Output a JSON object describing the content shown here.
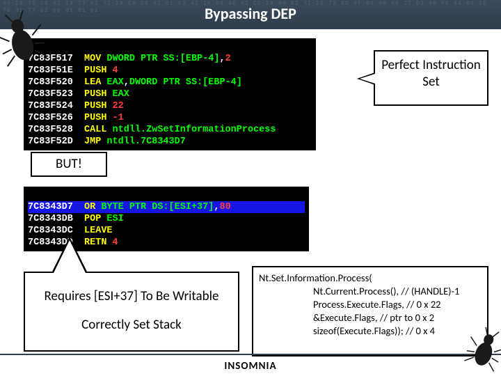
{
  "header": {
    "title": "Bypassing DEP"
  },
  "callouts": {
    "perfect": "Perfect Instruction Set",
    "but": "BUT!",
    "req_line1": "Requires [ESI+37] To Be Writable",
    "req_line2": "Correctly Set Stack"
  },
  "disasm1": [
    {
      "addr": "7C83F517",
      "mn": "MOV ",
      "ptr": "DWORD PTR SS:[EBP-4]",
      "comma": ",",
      "arg": "2",
      "arg_class": "num"
    },
    {
      "addr": "7C83F51E",
      "mn": "PUSH ",
      "arg": "4",
      "arg_class": "num"
    },
    {
      "addr": "7C83F520",
      "mn": "LEA ",
      "reg": "EAX",
      "comma": ",",
      "ptr": "DWORD PTR SS:[EBP-4]"
    },
    {
      "addr": "7C83F523",
      "mn": "PUSH ",
      "arg": "EAX",
      "arg_class": "ptr"
    },
    {
      "addr": "7C83F524",
      "mn": "PUSH ",
      "arg": "22",
      "arg_class": "num"
    },
    {
      "addr": "7C83F526",
      "mn": "PUSH ",
      "arg": "-1",
      "arg_class": "num"
    },
    {
      "addr": "7C83F528",
      "mn": "CALL ",
      "arg": "ntdll.ZwSetInformationProcess",
      "arg_class": "name"
    },
    {
      "addr": "7C83F52D",
      "mn": "JMP ",
      "arg": "ntdll.7C8343D7",
      "arg_class": "name"
    }
  ],
  "disasm2": [
    {
      "addr": "7C8343D7",
      "mn": "OR ",
      "ptr": "BYTE PTR DS:[ESI+37]",
      "comma": ",",
      "arg": "80",
      "arg_class": "num",
      "hl": true
    },
    {
      "addr": "7C8343DB",
      "mn": "POP ",
      "arg": "ESI",
      "arg_class": "ptr"
    },
    {
      "addr": "7C8343DC",
      "mn": "LEAVE",
      "arg": ""
    },
    {
      "addr": "7C8343DD",
      "mn": "RETN ",
      "arg": "4",
      "arg_class": "num"
    }
  ],
  "codebox": {
    "l0": "Nt.Set.Information.Process(",
    "l1": "Nt.Current.Process(), // (HANDLE)-1",
    "l2": "Process.Execute.Flags, // 0 x 22",
    "l3": "&Execute.Flags, // ptr to 0 x 2",
    "l4": "sizeof(Execute.Flags)); // 0 x 4"
  },
  "footer": {
    "logo": "INSOMNIA"
  }
}
